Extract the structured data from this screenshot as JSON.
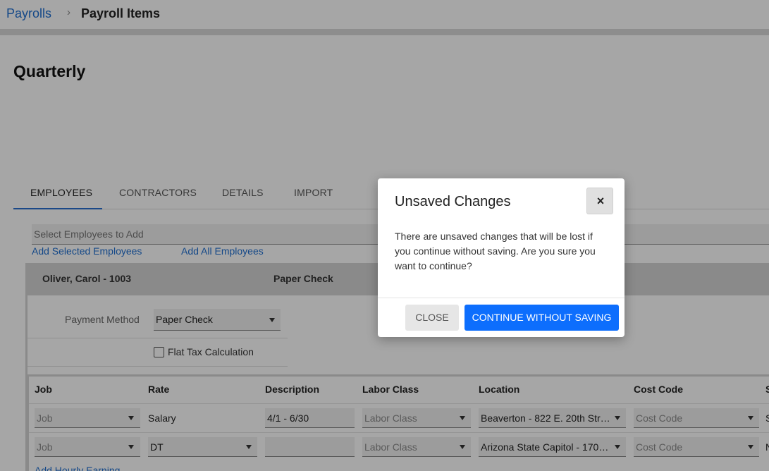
{
  "breadcrumb": {
    "parent": "Payrolls",
    "separator": "›",
    "current": "Payroll Items"
  },
  "page": {
    "title": "Quarterly"
  },
  "tabs": [
    {
      "label": "EMPLOYEES",
      "active": true
    },
    {
      "label": "CONTRACTORS"
    },
    {
      "label": "DETAILS"
    },
    {
      "label": "IMPORT"
    }
  ],
  "employee_picker": {
    "placeholder": "Select Employees to Add",
    "add_selected": "Add Selected Employees",
    "add_all": "Add All Employees"
  },
  "employee": {
    "name": "Oliver, Carol - 1003",
    "payment_method_summary": "Paper Check",
    "payment_method_label": "Payment Method",
    "payment_method_value": "Paper Check",
    "flat_tax_label": "Flat Tax Calculation",
    "flat_tax_checked": false
  },
  "table": {
    "headers": [
      "Job",
      "Rate",
      "Description",
      "Labor Class",
      "Location",
      "Cost Code",
      "S"
    ],
    "rows": [
      {
        "job": "Job",
        "rate": "Salary",
        "description": "4/1 - 6/30",
        "labor_class": "Labor Class",
        "location": "Beaverton - 822 E. 20th Str…",
        "cost_code": "Cost Code",
        "extra": "S"
      },
      {
        "job": "Job",
        "rate": "DT",
        "description": "",
        "labor_class": "Labor Class",
        "location": "Arizona State Capitol - 170…",
        "cost_code": "Cost Code",
        "extra": "N"
      }
    ],
    "add_hourly": "Add Hourly Earning"
  },
  "modal": {
    "title": "Unsaved Changes",
    "close_icon": "×",
    "message": "There are unsaved changes that will be lost if you continue without saving. Are you sure you want to continue?",
    "close_label": "CLOSE",
    "continue_label": "CONTINUE WITHOUT SAVING"
  },
  "colors": {
    "link": "#1f6fd1",
    "primary_button": "#0d6efd",
    "overlay": "rgba(0,0,0,0.35)"
  }
}
